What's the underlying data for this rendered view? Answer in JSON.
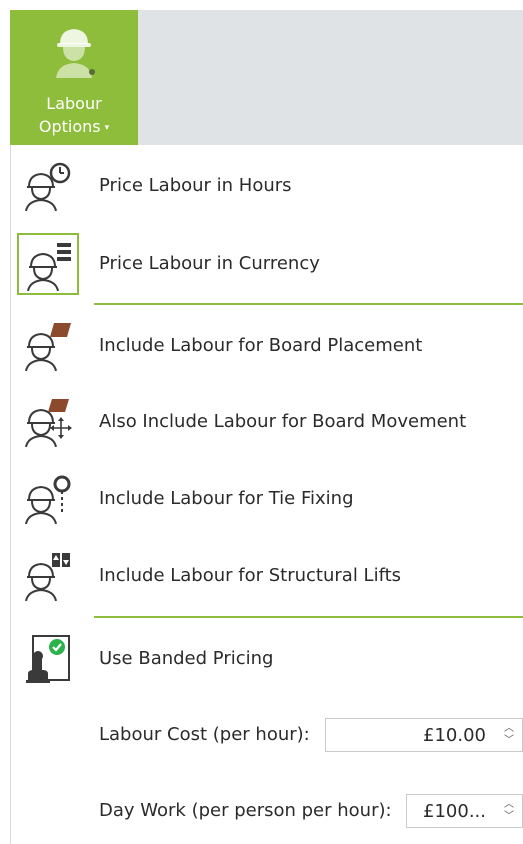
{
  "ribbon": {
    "button_line1": "Labour",
    "button_line2": "Options",
    "caret": "▾",
    "icon": "worker-hardhat-icon"
  },
  "menu": {
    "items": [
      {
        "label": "Price Labour in Hours",
        "icon": "worker-clock-icon",
        "selected": false
      },
      {
        "label": "Price Labour in Currency",
        "icon": "worker-list-icon",
        "selected": true
      },
      {
        "label": "Include Labour for Board Placement",
        "icon": "worker-board-icon",
        "selected": false
      },
      {
        "label": "Also Include Labour for Board Movement",
        "icon": "worker-board-move-icon",
        "selected": false
      },
      {
        "label": "Include Labour for Tie Fixing",
        "icon": "worker-tie-icon",
        "selected": false
      },
      {
        "label": "Include Labour for Structural Lifts",
        "icon": "worker-lifts-icon",
        "selected": false
      },
      {
        "label": "Use Banded Pricing",
        "icon": "banded-pricing-icon",
        "selected": false
      }
    ],
    "labour_cost_label": "Labour Cost (per hour):",
    "labour_cost_value": "£10.00",
    "day_work_label": "Day Work (per person per hour):",
    "day_work_value": "£100..."
  },
  "colors": {
    "accent": "#8dbd3a",
    "ribbon_bg": "#dfe3e6",
    "icon_dark": "#3a3a3a",
    "board_brown": "#8b4a2b",
    "check_green": "#2bb24c"
  }
}
